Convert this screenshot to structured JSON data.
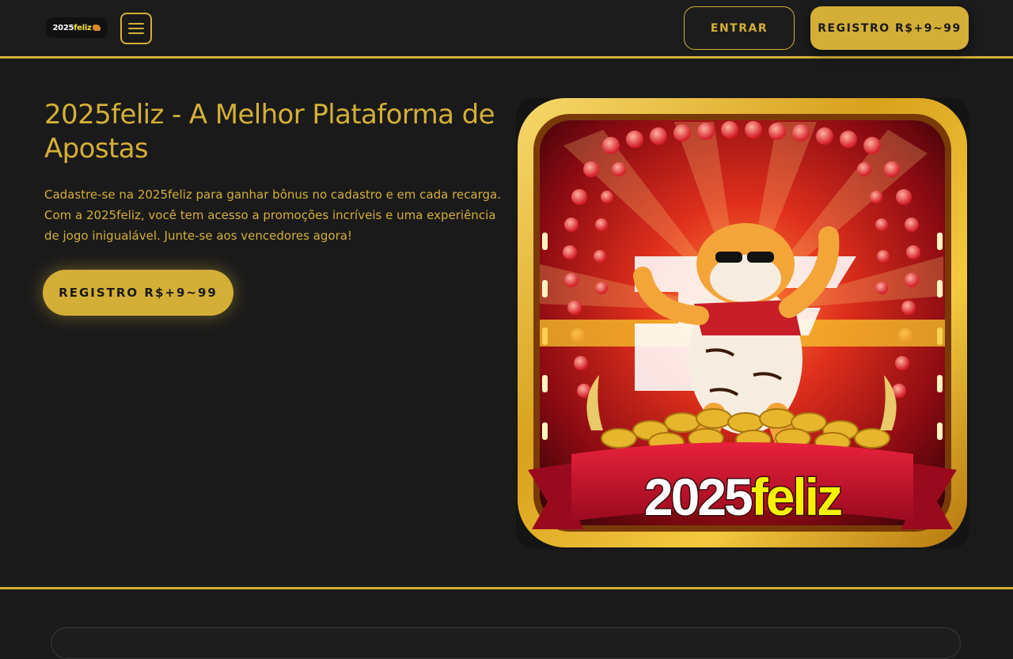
{
  "header": {
    "logo_text_main": "2025",
    "logo_text_accent": "feliz",
    "menu_icon": "hamburger-menu-icon",
    "login_label": "ENTRAR",
    "register_label": "REGISTRO R$+9~99"
  },
  "hero": {
    "title": "2025feliz - A Melhor Plataforma de Apostas",
    "description": "Cadastre-se na 2025feliz para ganhar bônus no cadastro e em cada recarga. Com a 2025feliz, você tem acesso a promoções incríveis e uma experiência de jogo inigualável. Junte-se aos vencedores agora!",
    "cta_label": "REGISTRO R$+9~99",
    "image": {
      "banner_main": "2025",
      "banner_accent": "feliz"
    }
  },
  "colors": {
    "background": "#1a1a1a",
    "accent_gold": "#d4af37",
    "banner_red": "#c8102e",
    "banner_yellow": "#f5f200"
  }
}
